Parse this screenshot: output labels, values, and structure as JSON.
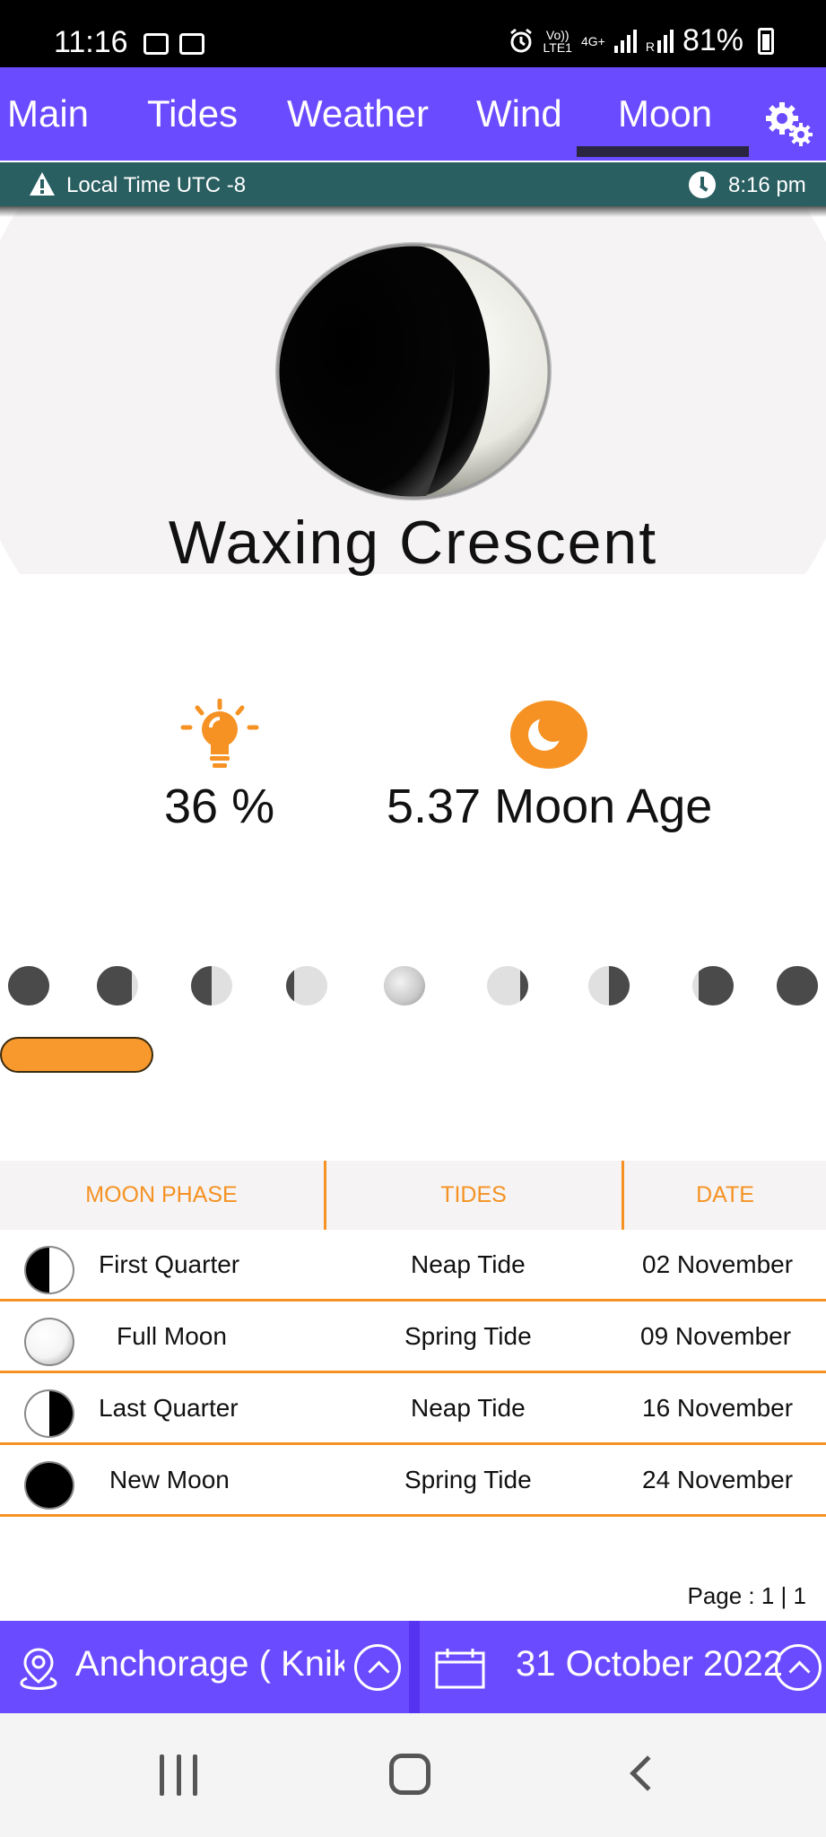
{
  "status_bar": {
    "time": "11:16",
    "network_top": "Vo))",
    "network_bottom": "LTE1",
    "net_type": "4G+",
    "roaming": "R",
    "battery": "81%"
  },
  "tabs": [
    {
      "label": "Main"
    },
    {
      "label": "Tides"
    },
    {
      "label": "Weather"
    },
    {
      "label": "Wind"
    },
    {
      "label": "Moon",
      "active": true
    }
  ],
  "settings_icon": "gears-icon",
  "info_bar": {
    "local_time": "Local Time UTC -8",
    "time": "8:16 pm"
  },
  "moon": {
    "phase": "Waxing Crescent",
    "illumination": "36 %",
    "age": "5.37 Moon Age"
  },
  "phase_strip": {
    "illumination_fractions": [
      0,
      0.15,
      0.5,
      0.8,
      1.0,
      0.8,
      0.5,
      0.15,
      0
    ],
    "selected_index": 0
  },
  "table": {
    "headers": [
      "MOON PHASE",
      "TIDES",
      "DATE"
    ],
    "rows": [
      {
        "phase": "First Quarter",
        "tide": "Neap Tide",
        "date": "02 November",
        "icon": "first-quarter"
      },
      {
        "phase": "Full Moon",
        "tide": "Spring Tide",
        "date": "09 November",
        "icon": "full-moon"
      },
      {
        "phase": "Last Quarter",
        "tide": "Neap Tide",
        "date": "16 November",
        "icon": "last-quarter"
      },
      {
        "phase": "New Moon",
        "tide": "Spring Tide",
        "date": "24 November",
        "icon": "new-moon"
      }
    ]
  },
  "pagination": "Page :  1 | 1",
  "bottom_bar": {
    "location": "Anchorage ( Knik A",
    "date": "31 October 2022"
  },
  "colors": {
    "accent": "#6a4bff",
    "orange": "#f59223",
    "info_bar": "#2a5f62"
  }
}
